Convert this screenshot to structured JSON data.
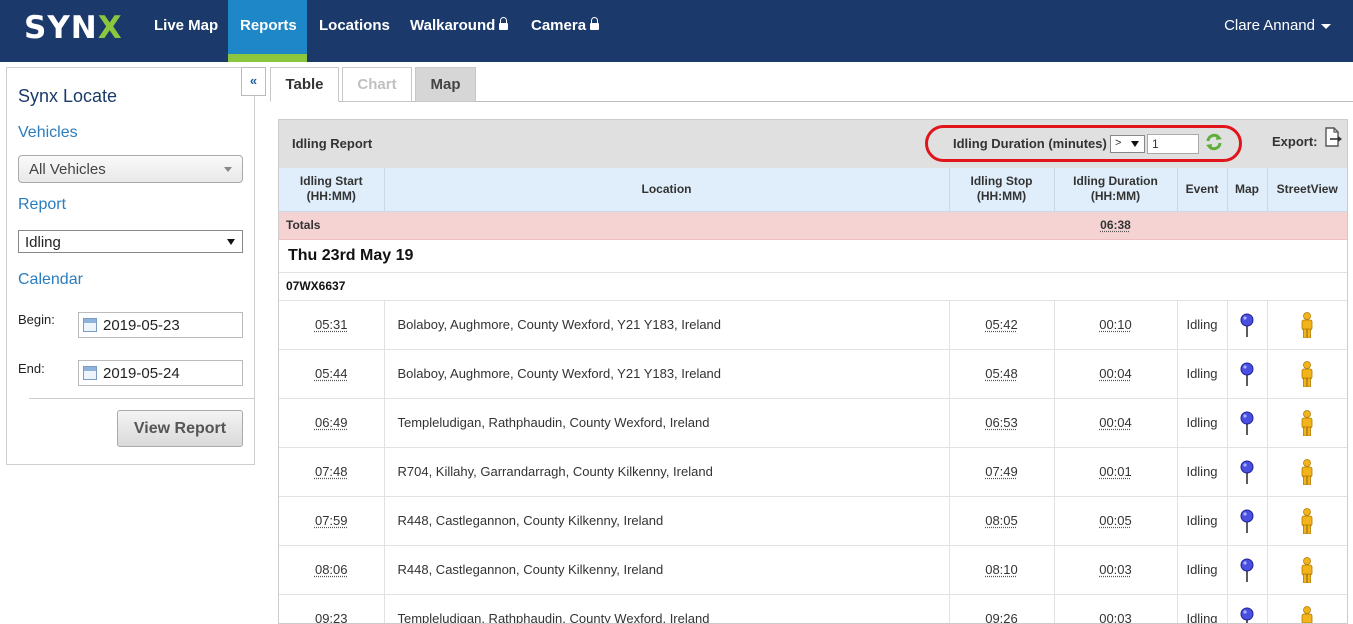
{
  "brand": {
    "logo_text_1": "SYN",
    "logo_text_2": "X",
    "accent": "#8cc63f",
    "nav_bg": "#1b3a6b",
    "active_bg": "#1d87c8"
  },
  "nav": {
    "items": [
      {
        "label": "Live Map",
        "locked": false,
        "active": false
      },
      {
        "label": "Reports",
        "locked": false,
        "active": true
      },
      {
        "label": "Locations",
        "locked": false,
        "active": false
      },
      {
        "label": "Walkaround",
        "locked": true,
        "active": false
      },
      {
        "label": "Camera",
        "locked": true,
        "active": false
      }
    ],
    "user": "Clare Annand"
  },
  "sidebar": {
    "collapse_label": "«",
    "title": "Synx Locate",
    "vehicles_label": "Vehicles",
    "vehicles_value": "All Vehicles",
    "report_label": "Report",
    "report_value": "Idling",
    "calendar_label": "Calendar",
    "begin_label": "Begin:",
    "begin_value": "2019-05-23",
    "end_label": "End:",
    "end_value": "2019-05-24",
    "view_button": "View Report"
  },
  "tabs": [
    {
      "label": "Table",
      "state": "active"
    },
    {
      "label": "Chart",
      "state": "disabled"
    },
    {
      "label": "Map",
      "state": "grey"
    }
  ],
  "report": {
    "title": "Idling Report",
    "filter_label": "Idling Duration (minutes)",
    "filter_operator": ">",
    "filter_value": "1",
    "export_label": "Export:",
    "columns": {
      "start": "Idling Start (HH:MM)",
      "location": "Location",
      "stop": "Idling Stop (HH:MM)",
      "duration": "Idling Duration (HH:MM)",
      "event": "Event",
      "map": "Map",
      "streetview": "StreetView"
    },
    "totals_label": "Totals",
    "totals_duration": "06:38",
    "date_heading": "Thu 23rd May 19",
    "vehicle": "07WX6637",
    "rows": [
      {
        "start": "05:31",
        "location": "Bolaboy, Aughmore, County Wexford, Y21 Y183, Ireland",
        "stop": "05:42",
        "duration": "00:10",
        "event": "Idling"
      },
      {
        "start": "05:44",
        "location": "Bolaboy, Aughmore, County Wexford, Y21 Y183, Ireland",
        "stop": "05:48",
        "duration": "00:04",
        "event": "Idling"
      },
      {
        "start": "06:49",
        "location": "Templeludigan, Rathphaudin, County Wexford, Ireland",
        "stop": "06:53",
        "duration": "00:04",
        "event": "Idling"
      },
      {
        "start": "07:48",
        "location": "R704, Killahy, Garrandarragh, County Kilkenny, Ireland",
        "stop": "07:49",
        "duration": "00:01",
        "event": "Idling"
      },
      {
        "start": "07:59",
        "location": "R448, Castlegannon, County Kilkenny, Ireland",
        "stop": "08:05",
        "duration": "00:05",
        "event": "Idling"
      },
      {
        "start": "08:06",
        "location": "R448, Castlegannon, County Kilkenny, Ireland",
        "stop": "08:10",
        "duration": "00:03",
        "event": "Idling"
      },
      {
        "start": "09:23",
        "location": "Templeludigan, Rathphaudin, County Wexford, Ireland",
        "stop": "09:26",
        "duration": "00:03",
        "event": "Idling"
      }
    ]
  }
}
